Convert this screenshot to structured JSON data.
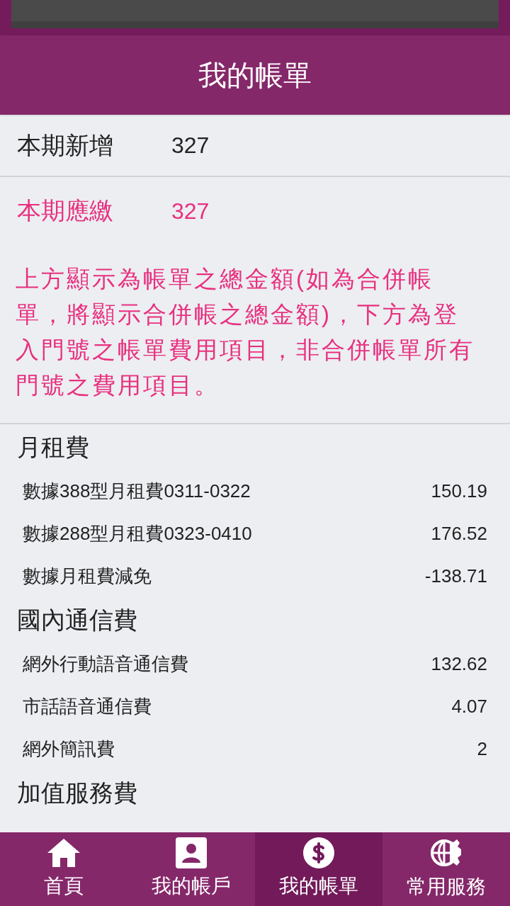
{
  "header": {
    "title": "我的帳單"
  },
  "summary": [
    {
      "label": "本期新增",
      "amount": "327",
      "highlight": false
    },
    {
      "label": "本期應繳",
      "amount": "327",
      "highlight": true
    }
  ],
  "note": "上方顯示為帳單之總金額(如為合併帳單，將顯示合併帳之總金額)，下方為登入門號之帳單費用項目，非合併帳單所有門號之費用項目。",
  "sections": [
    {
      "title": "月租費",
      "items": [
        {
          "name": "數據388型月租費0311-0322",
          "amount": "150.19"
        },
        {
          "name": "數據288型月租費0323-0410",
          "amount": "176.52"
        },
        {
          "name": "數據月租費減免",
          "amount": "-138.71"
        }
      ]
    },
    {
      "title": "國內通信費",
      "items": [
        {
          "name": "網外行動語音通信費",
          "amount": "132.62"
        },
        {
          "name": "市話語音通信費",
          "amount": "4.07"
        },
        {
          "name": "網外簡訊費",
          "amount": "2"
        }
      ]
    },
    {
      "title": "加值服務費"
    }
  ],
  "nav": [
    {
      "label": "首頁",
      "kind": "home",
      "selected": false
    },
    {
      "label": "我的帳戶",
      "kind": "account",
      "selected": false
    },
    {
      "label": "我的帳單",
      "kind": "bill",
      "selected": true
    },
    {
      "label": "常用服務",
      "kind": "services",
      "selected": false
    }
  ]
}
